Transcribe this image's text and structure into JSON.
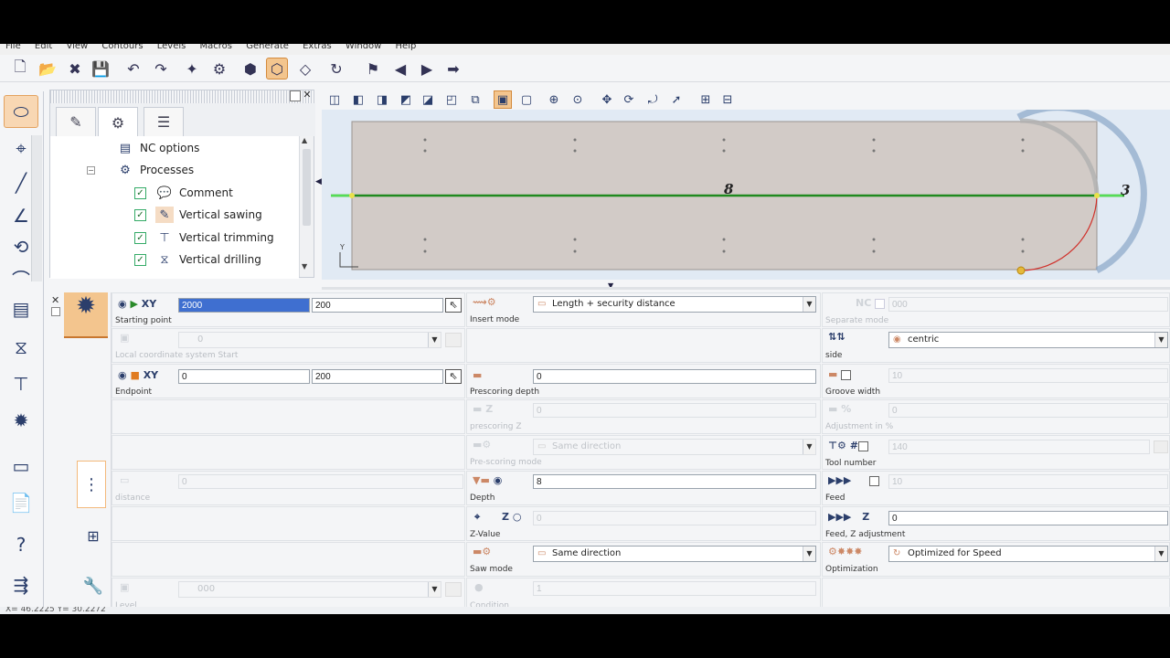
{
  "menu": [
    "File",
    "Edit",
    "View",
    "Contours",
    "Levels",
    "Macros",
    "Generate",
    "Extras",
    "Window",
    "Help"
  ],
  "tree": {
    "items": [
      {
        "label": "NC options",
        "icon": "nc-options-icon",
        "checked": null
      },
      {
        "label": "Processes",
        "icon": "processes-icon",
        "checked": null
      },
      {
        "label": "Comment",
        "icon": "comment-icon",
        "checked": true
      },
      {
        "label": "Vertical sawing",
        "icon": "saw-icon",
        "checked": true
      },
      {
        "label": "Vertical trimming",
        "icon": "trim-icon",
        "checked": true
      },
      {
        "label": "Vertical drilling",
        "icon": "drill-icon",
        "checked": true
      }
    ]
  },
  "canvas": {
    "line_label": "8",
    "end_label": "3",
    "axis_y": "Y"
  },
  "props": {
    "start_tag": "XY",
    "start_x": "2000",
    "start_y": "200",
    "start_label": "Starting point",
    "local_coord_label": "Local coordinate system Start",
    "local_coord_value": "0",
    "end_tag": "XY",
    "end_x": "0",
    "end_y": "200",
    "end_label": "Endpoint",
    "distance_label": "distance",
    "distance_value": "0",
    "level_label": "Level",
    "level_value": "000",
    "insert_mode_label": "Insert mode",
    "insert_mode_value": "Length + security distance",
    "prescoring_depth_label": "Prescoring depth",
    "prescoring_depth_value": "0",
    "prescoring_z_label": "prescoring Z",
    "prescoring_z_value": "0",
    "prescoring_mode_label": "Pre-scoring mode",
    "prescoring_mode_value": "Same direction",
    "depth_label": "Depth",
    "depth_value": "8",
    "zvalue_label": "Z-Value",
    "zvalue_value": "0",
    "saw_mode_label": "Saw mode",
    "saw_mode_value": "Same direction",
    "condition_label": "Condition",
    "condition_value": "1",
    "separate_mode_label": "Separate mode",
    "separate_mode_value": "000",
    "side_label": "side",
    "side_value": "centric",
    "groove_width_label": "Groove width",
    "groove_width_value": "10",
    "adjust_pct_label": "Adjustment in %",
    "adjust_pct_value": "0",
    "tool_number_label": "Tool number",
    "tool_number_value": "140",
    "feed_label": "Feed",
    "feed_value": "10",
    "feed_z_label": "Feed, Z adjustment",
    "feed_z_value": "0",
    "optimization_label": "Optimization",
    "optimization_value": "Optimized for Speed",
    "tag_nc": "NC",
    "tag_z": "Z",
    "tag_pct": "%",
    "tag_hash": "#",
    "tag_z_only": "Z"
  },
  "status": {
    "coords": "X= 46.2225 Y= 30.2272"
  },
  "colors": {
    "accent": "#f3c58e",
    "panel": "#d2cbc7",
    "tool_path": "#1f8a1f"
  }
}
